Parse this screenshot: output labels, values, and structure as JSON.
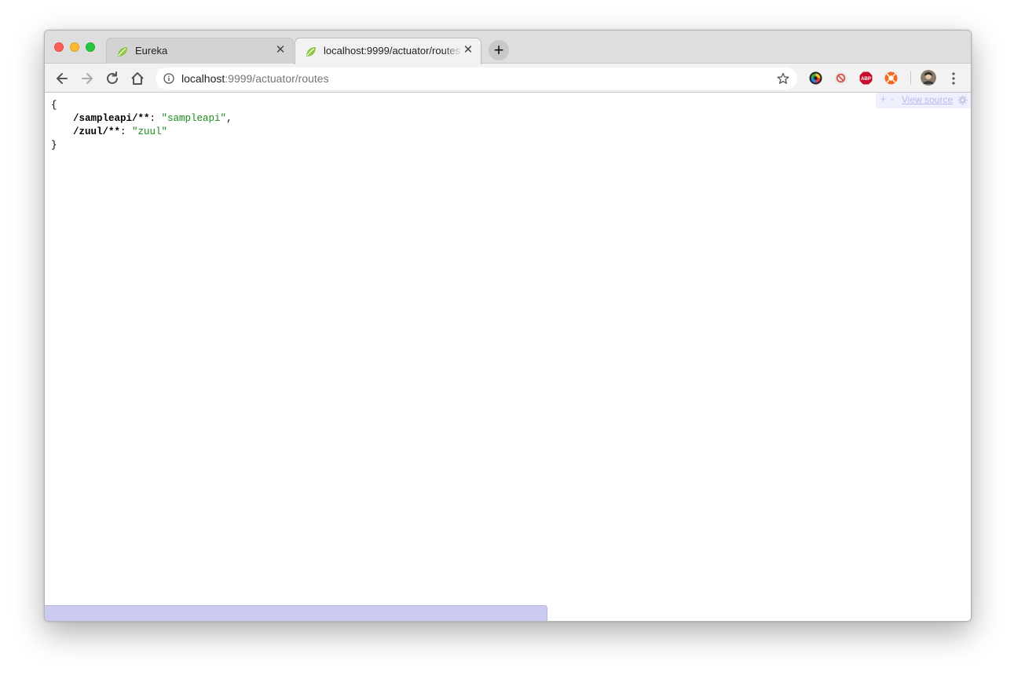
{
  "tabs": [
    {
      "title": "Eureka",
      "active": false
    },
    {
      "title": "localhost:9999/actuator/routes",
      "active": true
    }
  ],
  "toolbar": {
    "url_host": "localhost",
    "url_path": ":9999/actuator/routes"
  },
  "json_view": {
    "open_brace": "{",
    "close_brace": "}",
    "entries": [
      {
        "key": "/sampleapi/**",
        "value": "\"sampleapi\"",
        "trailing": ","
      },
      {
        "key": "/zuul/**",
        "value": "\"zuul\"",
        "trailing": ""
      }
    ],
    "toolbar": {
      "expand": "+",
      "collapse": "-",
      "view_source": "View source"
    }
  },
  "colors": {
    "string_value": "#1a8a1a",
    "view_source_bar": "#eef0fd",
    "status_bar": "#cbcbf1"
  },
  "icons": {
    "extensions": [
      "color-picker-icon",
      "block-icon",
      "adblock-plus-icon",
      "orange-extension-icon",
      "profile-avatar-icon"
    ]
  }
}
